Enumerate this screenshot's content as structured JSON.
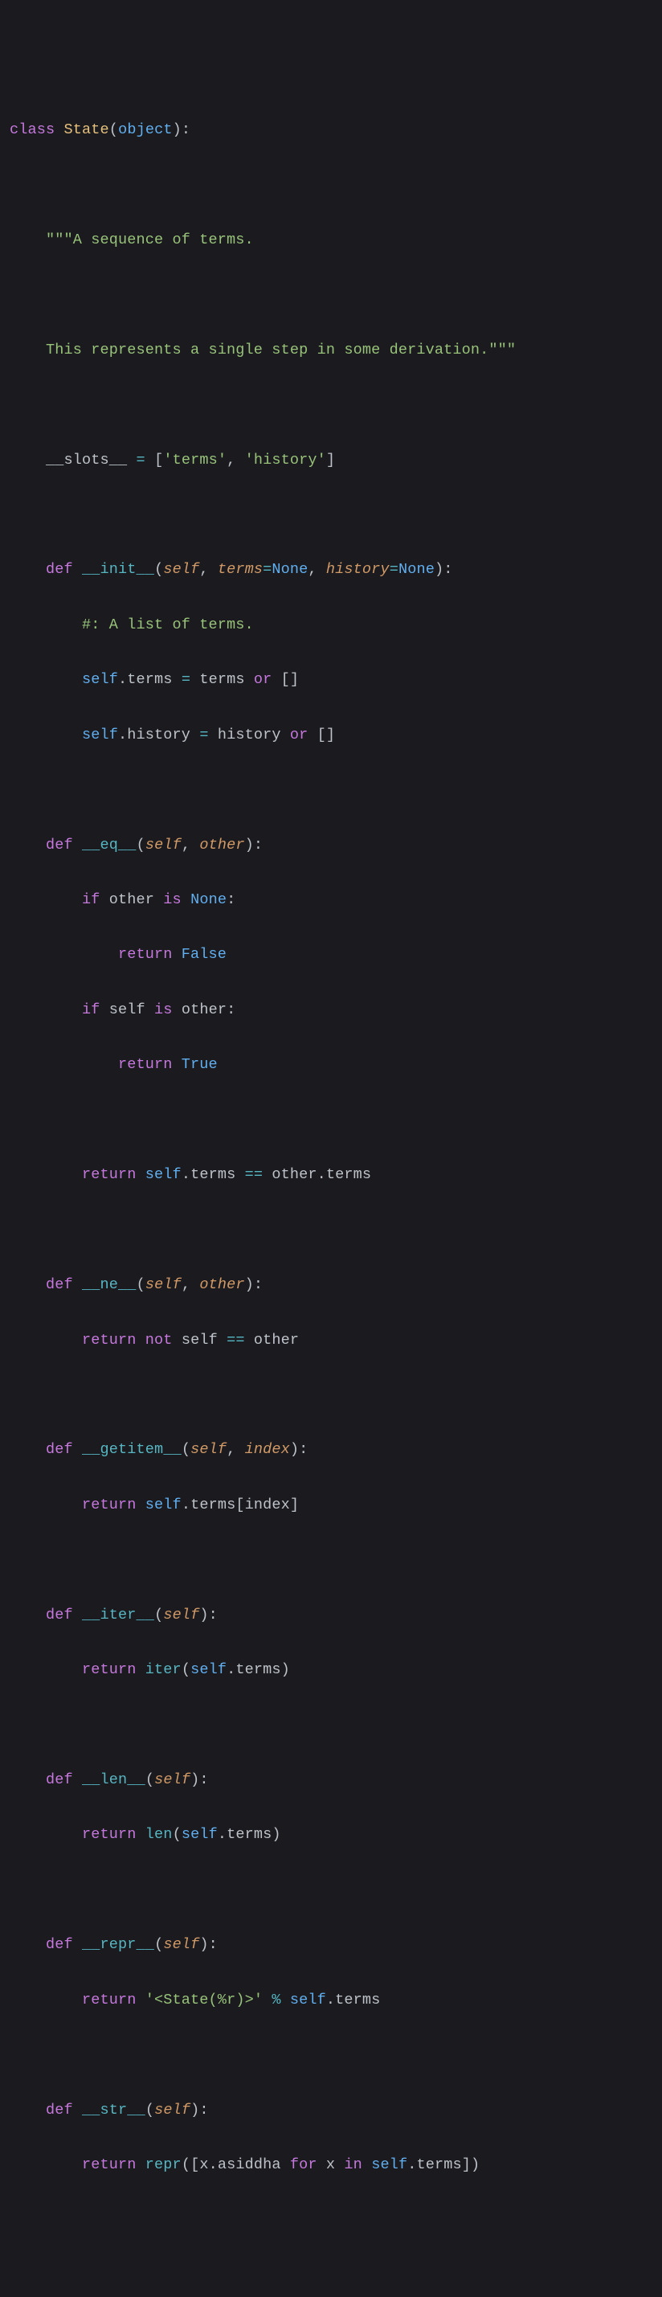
{
  "code": {
    "l1": {
      "class_kw": "class",
      "cls_name": "State",
      "lp": "(",
      "obj": "object",
      "rp": ")",
      "colon": ":"
    },
    "l3": {
      "doc": "\"\"\"A sequence of terms."
    },
    "l5": {
      "doc": "This represents a single step in some derivation.\"\"\""
    },
    "l7": {
      "slots": "__slots__",
      "eq": " = ",
      "lb": "[",
      "s1": "'terms'",
      "comma": ", ",
      "s2": "'history'",
      "rb": "]"
    },
    "l9": {
      "def": "def",
      "name": "__init__",
      "lp": "(",
      "self": "self",
      "c1": ", ",
      "p1": "terms",
      "e1": "=",
      "n1": "None",
      "c2": ", ",
      "p2": "history",
      "e2": "=",
      "n2": "None",
      "rp": ")",
      "colon": ":"
    },
    "l10": {
      "comment": "#: A list of terms."
    },
    "l11": {
      "self": "self",
      "dot": ".",
      "prop": "terms",
      "eq": " = ",
      "rhs": "terms",
      "or": " or ",
      "br": "[]"
    },
    "l12": {
      "self": "self",
      "dot": ".",
      "prop": "history",
      "eq": " = ",
      "rhs": "history",
      "or": " or ",
      "br": "[]"
    },
    "l14": {
      "def": "def",
      "name": "__eq__",
      "lp": "(",
      "self": "self",
      "c1": ", ",
      "other": "other",
      "rp": ")",
      "colon": ":"
    },
    "l15": {
      "if": "if",
      "other": " other ",
      "is": "is",
      "none": " None",
      "colon": ":"
    },
    "l16": {
      "ret": "return",
      "val": " False"
    },
    "l17": {
      "if": "if",
      "self": " self ",
      "is": "is",
      "other": " other",
      "colon": ":"
    },
    "l18": {
      "ret": "return",
      "val": " True"
    },
    "l20": {
      "ret": "return",
      "sp": " ",
      "self": "self",
      "dot": ".",
      "prop": "terms",
      "eqeq": " == ",
      "other": "other",
      "dot2": ".",
      "prop2": "terms"
    },
    "l22": {
      "def": "def",
      "name": "__ne__",
      "lp": "(",
      "self": "self",
      "c1": ", ",
      "other": "other",
      "rp": ")",
      "colon": ":"
    },
    "l23": {
      "ret": "return",
      "sp": " ",
      "not": "not",
      "self": " self ",
      "eqeq": "==",
      "other": " other"
    },
    "l25": {
      "def": "def",
      "name": "__getitem__",
      "lp": "(",
      "self": "self",
      "c1": ", ",
      "idx": "index",
      "rp": ")",
      "colon": ":"
    },
    "l26": {
      "ret": "return",
      "sp": " ",
      "self": "self",
      "dot": ".",
      "prop": "terms",
      "lb": "[",
      "idx": "index",
      "rb": "]"
    },
    "l28": {
      "def": "def",
      "name": "__iter__",
      "lp": "(",
      "self": "self",
      "rp": ")",
      "colon": ":"
    },
    "l29": {
      "ret": "return",
      "sp": " ",
      "fn": "iter",
      "lp": "(",
      "self": "self",
      "dot": ".",
      "prop": "terms",
      "rp": ")"
    },
    "l31": {
      "def": "def",
      "name": "__len__",
      "lp": "(",
      "self": "self",
      "rp": ")",
      "colon": ":"
    },
    "l32": {
      "ret": "return",
      "sp": " ",
      "fn": "len",
      "lp": "(",
      "self": "self",
      "dot": ".",
      "prop": "terms",
      "rp": ")"
    },
    "l34": {
      "def": "def",
      "name": "__repr__",
      "lp": "(",
      "self": "self",
      "rp": ")",
      "colon": ":"
    },
    "l35": {
      "ret": "return",
      "sp": " ",
      "str": "'<State(%r)>'",
      "pct": " % ",
      "self": "self",
      "dot": ".",
      "prop": "terms"
    },
    "l37": {
      "def": "def",
      "name": "__str__",
      "lp": "(",
      "self": "self",
      "rp": ")",
      "colon": ":"
    },
    "l38": {
      "ret": "return",
      "sp": " ",
      "fn": "repr",
      "lp": "(",
      "lb": "[",
      "x": "x",
      "dot": ".",
      "prop": "asiddha",
      "for": " for ",
      "x2": "x",
      "in": " in ",
      "self": "self",
      "dot2": ".",
      "prop2": "terms",
      "rb": "]",
      "rp": ")"
    }
  }
}
